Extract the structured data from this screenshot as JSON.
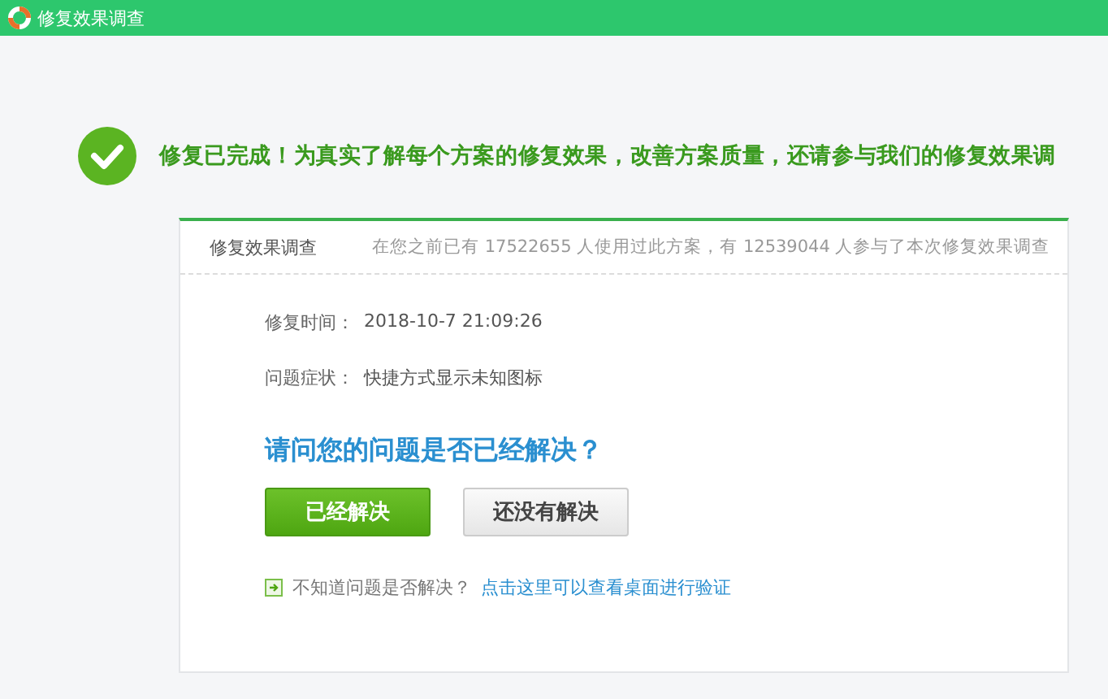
{
  "window": {
    "title": "修复效果调查"
  },
  "banner": {
    "message": "修复已完成！为真实了解每个方案的修复效果，改善方案质量，还请参与我们的修复效果调"
  },
  "card": {
    "title": "修复效果调查",
    "stats": "在您之前已有 17522655 人使用过此方案，有 12539044 人参与了本次修复效果调查",
    "fields": [
      {
        "label": "修复时间：",
        "value": "2018-10-7 21:09:26"
      },
      {
        "label": "问题症状：",
        "value": "快捷方式显示未知图标"
      }
    ],
    "question": "请问您的问题是否已经解决？",
    "buttons": [
      {
        "label": "已经解决",
        "kind": "primary"
      },
      {
        "label": "还没有解决",
        "kind": "secondary"
      }
    ],
    "hint": {
      "text": "不知道问题是否解决？",
      "link": "点击这里可以查看桌面进行验证"
    }
  }
}
